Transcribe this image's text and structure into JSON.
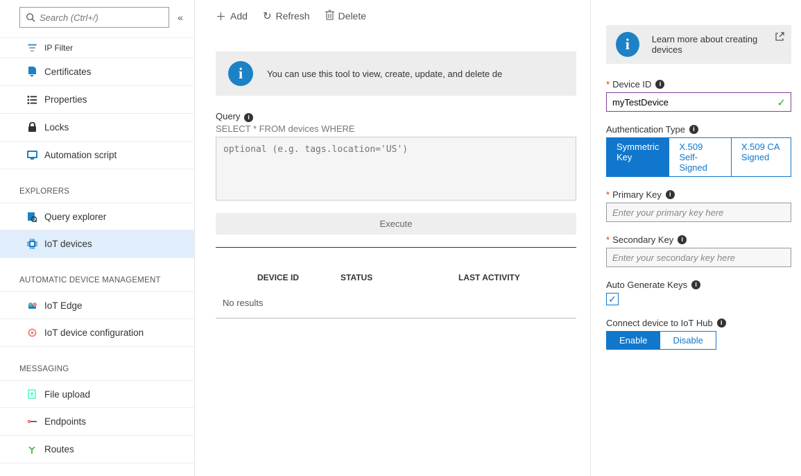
{
  "sidebar": {
    "search_placeholder": "Search (Ctrl+/)",
    "items_top": [
      {
        "label": "IP Filter"
      },
      {
        "label": "Certificates"
      },
      {
        "label": "Properties"
      },
      {
        "label": "Locks"
      },
      {
        "label": "Automation script"
      }
    ],
    "section_explorers": "EXPLORERS",
    "items_explorers": [
      {
        "label": "Query explorer"
      },
      {
        "label": "IoT devices",
        "selected": true
      }
    ],
    "section_adm": "AUTOMATIC DEVICE MANAGEMENT",
    "items_adm": [
      {
        "label": "IoT Edge"
      },
      {
        "label": "IoT device configuration"
      }
    ],
    "section_msg": "MESSAGING",
    "items_msg": [
      {
        "label": "File upload"
      },
      {
        "label": "Endpoints"
      },
      {
        "label": "Routes"
      }
    ]
  },
  "toolbar": {
    "add": "Add",
    "refresh": "Refresh",
    "delete": "Delete"
  },
  "info_banner": "You can use this tool to view, create, update, and delete de",
  "query": {
    "label": "Query",
    "sql": "SELECT * FROM devices WHERE",
    "placeholder": "optional (e.g. tags.location='US')",
    "execute": "Execute"
  },
  "table": {
    "col_device": "DEVICE ID",
    "col_status": "STATUS",
    "col_activity": "LAST ACTIVITY",
    "no_results": "No results"
  },
  "panel": {
    "learn_more": "Learn more about creating devices",
    "device_id_label": "Device ID",
    "device_id_value": "myTestDevice",
    "auth_type_label": "Authentication Type",
    "auth_opts": [
      "Symmetric Key",
      "X.509 Self-Signed",
      "X.509 CA Signed"
    ],
    "primary_key_label": "Primary Key",
    "primary_key_placeholder": "Enter your primary key here",
    "secondary_key_label": "Secondary Key",
    "secondary_key_placeholder": "Enter your secondary key here",
    "auto_gen_label": "Auto Generate Keys",
    "connect_label": "Connect device to IoT Hub",
    "connect_opts": [
      "Enable",
      "Disable"
    ]
  }
}
